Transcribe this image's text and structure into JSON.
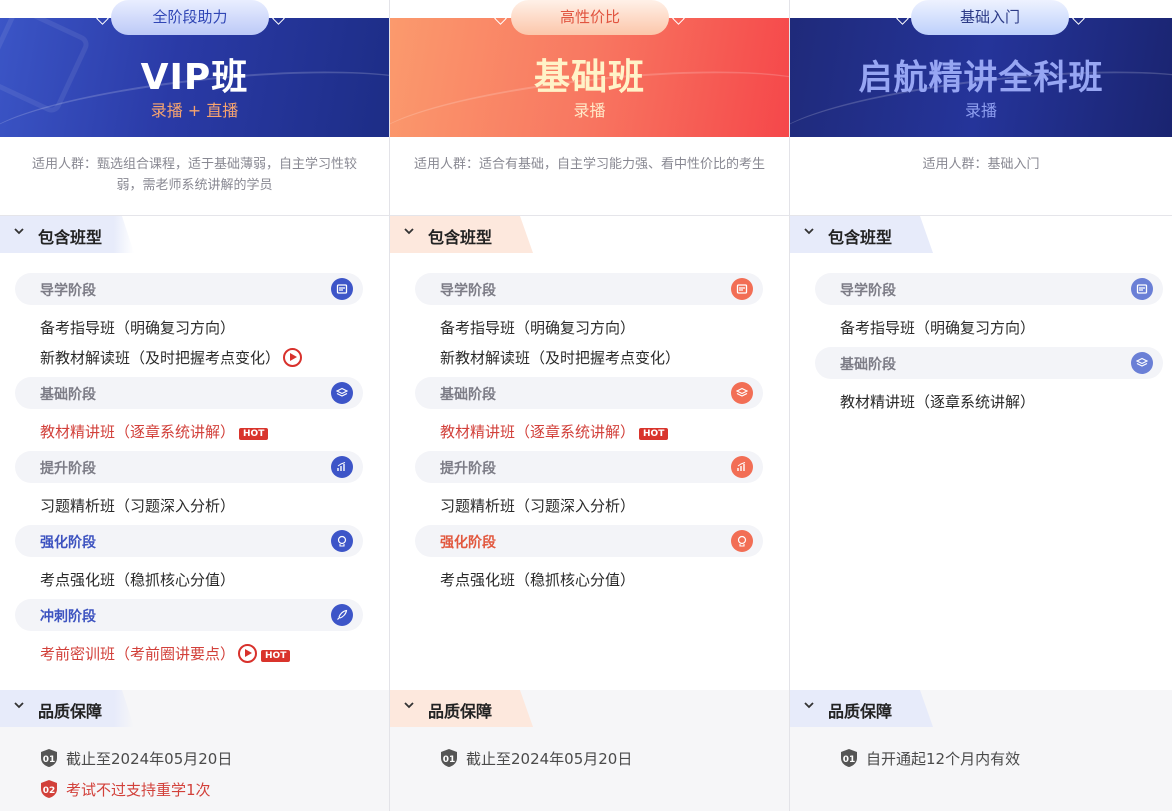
{
  "columns": [
    {
      "badge": "全阶段助力",
      "title": "VIP班",
      "subtitle": "录播 + 直播",
      "audience": "适用人群：甄选组合课程，适于基础薄弱，自主学习性较弱，需老师系统讲解的学员",
      "section_title": "包含班型",
      "stages": [
        {
          "label": "导学阶段",
          "icon": "guide-icon",
          "items": [
            {
              "text": "备考指导班（明确复习方向）"
            },
            {
              "text": "新教材解读班（及时把握考点变化）",
              "play": true
            }
          ]
        },
        {
          "label": "基础阶段",
          "icon": "layers-icon",
          "items": [
            {
              "text": "教材精讲班（逐章系统讲解）",
              "hot": "HOT",
              "red": true
            }
          ]
        },
        {
          "label": "提升阶段",
          "icon": "chart-up-icon",
          "items": [
            {
              "text": "习题精析班（习题深入分析）"
            }
          ]
        },
        {
          "label": "强化阶段",
          "icon": "brain-icon",
          "items": [
            {
              "text": "考点强化班（稳抓核心分值）"
            }
          ]
        },
        {
          "label": "冲刺阶段",
          "icon": "rocket-icon",
          "items": [
            {
              "text": "考前密训班（考前圈讲要点）",
              "play": true,
              "hot": "HOT",
              "red": true
            }
          ]
        }
      ],
      "quality_title": "品质保障",
      "quality": [
        {
          "num": "01",
          "text": "截止至2024年05月20日"
        },
        {
          "num": "02",
          "text": "考试不过支持重学1次",
          "red": true
        }
      ]
    },
    {
      "badge": "高性价比",
      "title": "基础班",
      "subtitle": "录播",
      "audience": "适用人群：适合有基础，自主学习能力强、看中性价比的考生",
      "section_title": "包含班型",
      "stages": [
        {
          "label": "导学阶段",
          "icon": "guide-icon",
          "items": [
            {
              "text": "备考指导班（明确复习方向）"
            },
            {
              "text": "新教材解读班（及时把握考点变化）"
            }
          ]
        },
        {
          "label": "基础阶段",
          "icon": "layers-icon",
          "items": [
            {
              "text": "教材精讲班（逐章系统讲解）",
              "hot": "HOT",
              "red": true
            }
          ]
        },
        {
          "label": "提升阶段",
          "icon": "chart-up-icon",
          "items": [
            {
              "text": "习题精析班（习题深入分析）"
            }
          ]
        },
        {
          "label": "强化阶段",
          "icon": "brain-icon",
          "items": [
            {
              "text": "考点强化班（稳抓核心分值）"
            }
          ]
        }
      ],
      "quality_title": "品质保障",
      "quality": [
        {
          "num": "01",
          "text": "截止至2024年05月20日"
        }
      ]
    },
    {
      "badge": "基础入门",
      "title": "启航精讲全科班",
      "subtitle": "录播",
      "audience": "适用人群：基础入门",
      "section_title": "包含班型",
      "stages": [
        {
          "label": "导学阶段",
          "icon": "guide-icon",
          "items": [
            {
              "text": "备考指导班（明确复习方向）"
            }
          ]
        },
        {
          "label": "基础阶段",
          "icon": "layers-icon",
          "items": [
            {
              "text": "教材精讲班（逐章系统讲解）"
            }
          ]
        }
      ],
      "quality_title": "品质保障",
      "quality": [
        {
          "num": "01",
          "text": "自开通起12个月内有效"
        }
      ]
    }
  ],
  "colors": {
    "vip_accent": "#3d55c8",
    "basic_accent": "#f26e55",
    "starter_accent": "#6a7fd6",
    "hot_red": "#d9342c"
  }
}
